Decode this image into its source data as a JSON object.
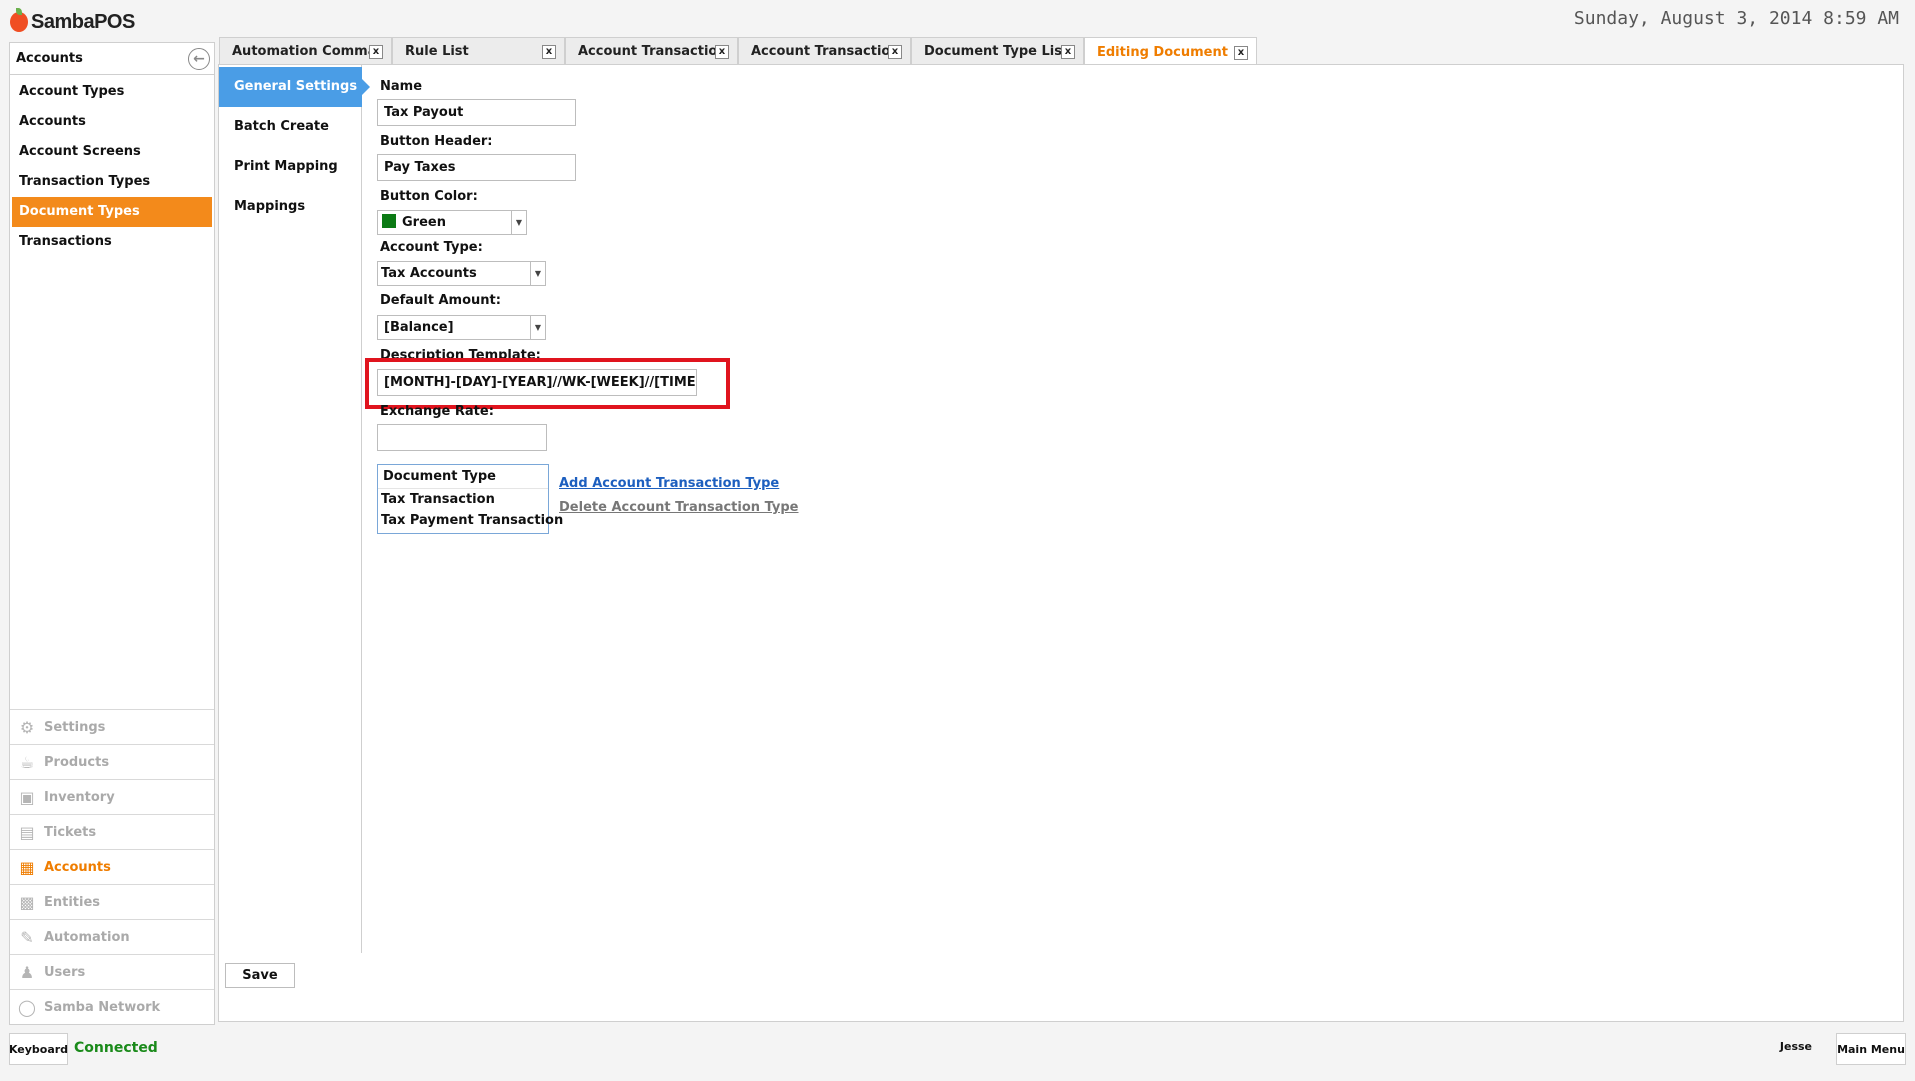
{
  "app": {
    "logo_text": "SambaPOS",
    "datetime": "Sunday, August 3, 2014 8:59 AM"
  },
  "left_panel": {
    "title": "Accounts",
    "items": [
      {
        "label": "Account Types"
      },
      {
        "label": "Accounts"
      },
      {
        "label": "Account Screens"
      },
      {
        "label": "Transaction Types"
      },
      {
        "label": "Document Types",
        "active": true
      },
      {
        "label": "Transactions"
      }
    ],
    "modules": [
      {
        "label": "Settings",
        "icon": "gear-icon"
      },
      {
        "label": "Products",
        "icon": "coffee-cup-icon"
      },
      {
        "label": "Inventory",
        "icon": "boxes-icon"
      },
      {
        "label": "Tickets",
        "icon": "books-icon"
      },
      {
        "label": "Accounts",
        "icon": "calculator-icon",
        "active": true
      },
      {
        "label": "Entities",
        "icon": "table-icon"
      },
      {
        "label": "Automation",
        "icon": "pen-icon"
      },
      {
        "label": "Users",
        "icon": "user-icon"
      },
      {
        "label": "Samba Network",
        "icon": "globe-icon"
      }
    ]
  },
  "tabs": [
    {
      "label": "Automation Commands"
    },
    {
      "label": "Rule List"
    },
    {
      "label": "Account Transaction"
    },
    {
      "label": "Account Transaction"
    },
    {
      "label": "Document Type List"
    },
    {
      "label": "Editing Document Type",
      "active": true
    }
  ],
  "subnav": [
    {
      "label": "General Settings",
      "active": true
    },
    {
      "label": "Batch Create"
    },
    {
      "label": "Print Mapping"
    },
    {
      "label": "Mappings"
    }
  ],
  "form": {
    "name_label": "Name",
    "name_value": "Tax Payout",
    "button_header_label": "Button Header:",
    "button_header_value": "Pay Taxes",
    "button_color_label": "Button Color:",
    "button_color_value": "Green",
    "button_color_hex": "#0b7a14",
    "account_type_label": "Account Type:",
    "account_type_value": "Tax Accounts",
    "default_amount_label": "Default Amount:",
    "default_amount_value": "[Balance]",
    "description_template_label": "Description Template:",
    "description_template_value": "[MONTH]-[DAY]-[YEAR]//WK-[WEEK]//[TIME]",
    "exchange_rate_label": "Exchange Rate:",
    "exchange_rate_value": ""
  },
  "transaction_list": {
    "header": "Document Type",
    "rows": [
      "Tax Transaction",
      "Tax Payment Transaction"
    ]
  },
  "links": {
    "add": "Add Account Transaction Type",
    "delete": "Delete Account Transaction Type"
  },
  "save_label": "Save",
  "status": {
    "keyboard_label": "Keyboard",
    "connection": "Connected",
    "user": "Jesse",
    "main_menu_label": "Main Menu"
  },
  "colors": {
    "accent_orange": "#f38a1b",
    "subnav_blue": "#4a9de6",
    "highlight_red": "#e0141e",
    "connected_green": "#1a8a1a"
  }
}
